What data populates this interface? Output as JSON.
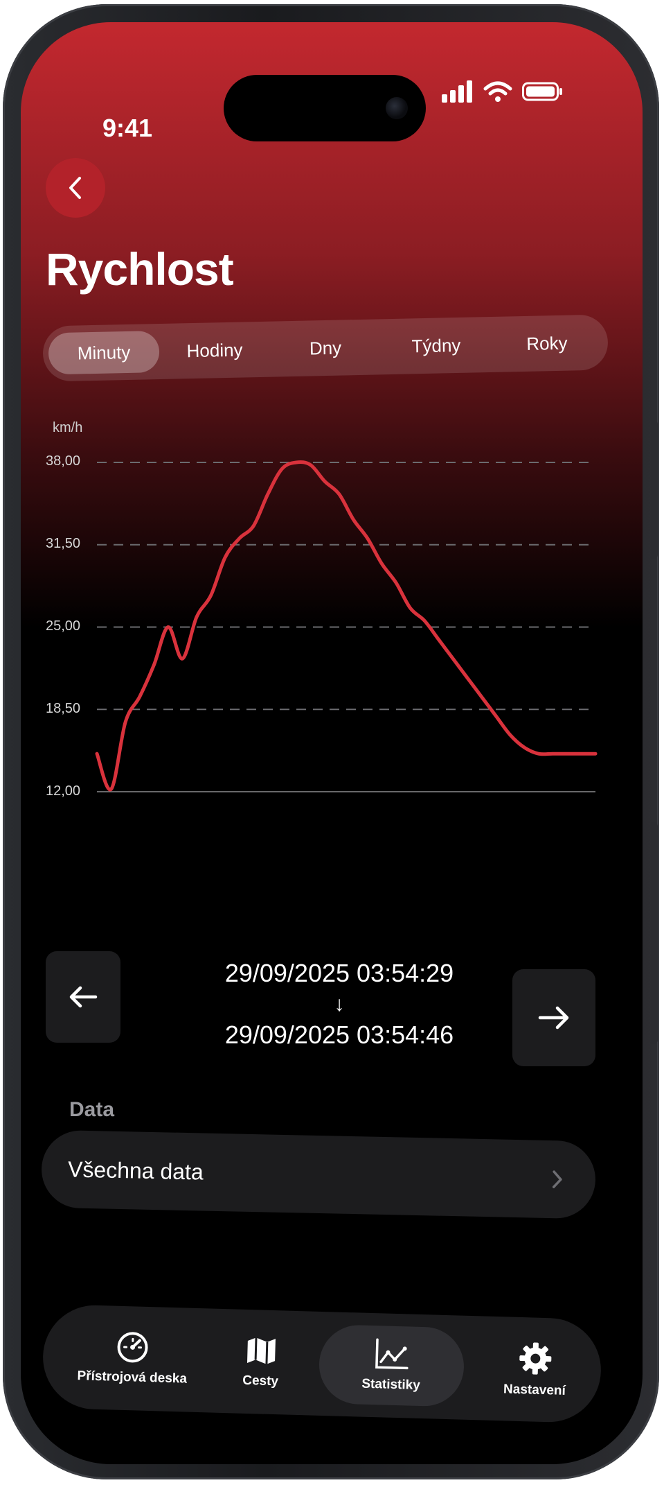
{
  "status_bar": {
    "time": "9:41"
  },
  "header": {
    "title": "Rychlost",
    "back_icon": "chevron-left-icon"
  },
  "period_tabs": [
    {
      "label": "Minuty",
      "active": true
    },
    {
      "label": "Hodiny",
      "active": false
    },
    {
      "label": "Dny",
      "active": false
    },
    {
      "label": "Týdny",
      "active": false
    },
    {
      "label": "Roky",
      "active": false
    }
  ],
  "chart_data": {
    "type": "line",
    "ylabel": "km/h",
    "ylim": [
      12.0,
      38.0
    ],
    "yticks": [
      "38,00",
      "31,50",
      "25,00",
      "18,50",
      "12,00"
    ],
    "grid": true,
    "series_color": "#d9323c",
    "x": [
      1,
      2,
      3,
      4,
      5,
      6,
      7,
      8,
      9,
      10,
      11,
      12,
      13,
      14,
      15,
      16,
      17,
      18,
      19,
      20,
      21,
      22,
      23,
      24,
      25,
      26,
      27,
      28,
      29,
      30,
      31,
      32,
      33,
      34,
      35,
      36
    ],
    "y": [
      15.0,
      12.2,
      17.5,
      19.5,
      22.0,
      25.0,
      22.5,
      25.8,
      27.5,
      30.5,
      32.0,
      33.0,
      35.5,
      37.5,
      38.0,
      37.8,
      36.5,
      35.5,
      33.5,
      32.0,
      30.0,
      28.5,
      26.5,
      25.5,
      24.0,
      22.5,
      21.0,
      19.5,
      18.0,
      16.5,
      15.5,
      15.0,
      15.0,
      15.0,
      15.0,
      15.0
    ]
  },
  "range": {
    "from": "29/09/2025 03:54:29",
    "separator": "↓",
    "to": "29/09/2025 03:54:46"
  },
  "data_section": {
    "label": "Data",
    "row_label": "Všechna data"
  },
  "tabbar": [
    {
      "label": "Přístrojová deska",
      "icon": "gauge-icon",
      "active": false
    },
    {
      "label": "Cesty",
      "icon": "map-icon",
      "active": false
    },
    {
      "label": "Statistiky",
      "icon": "chart-icon",
      "active": true
    },
    {
      "label": "Nastavení",
      "icon": "gear-icon",
      "active": false
    }
  ]
}
